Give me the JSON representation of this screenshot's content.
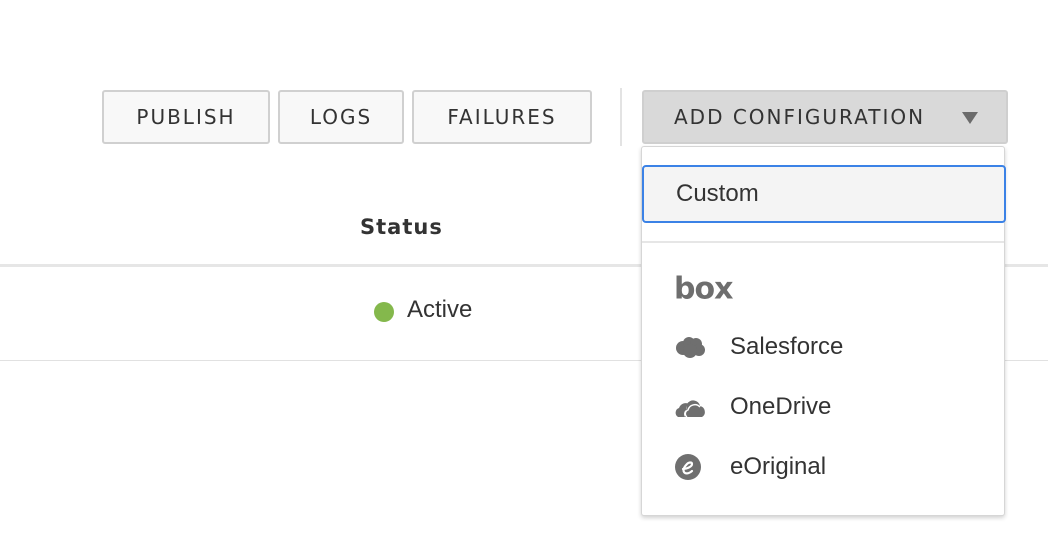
{
  "toolbar": {
    "publish_label": "PUBLISH",
    "logs_label": "LOGS",
    "failures_label": "FAILURES",
    "add_configuration_label": "ADD CONFIGURATION"
  },
  "table": {
    "columns": [
      "Status"
    ],
    "rows": [
      {
        "status": "Active",
        "status_color": "#84b84c"
      }
    ]
  },
  "dropdown": {
    "custom_label": "Custom",
    "integrations": [
      {
        "label": "box",
        "icon": "box-logo-icon"
      },
      {
        "label": "Salesforce",
        "icon": "salesforce-cloud-icon"
      },
      {
        "label": "OneDrive",
        "icon": "onedrive-cloud-icon"
      },
      {
        "label": "eOriginal",
        "icon": "eoriginal-icon"
      }
    ]
  },
  "colors": {
    "focus_ring": "#3b82e6",
    "active_status": "#84b84c",
    "primary_button_bg": "#d9d9d9"
  }
}
